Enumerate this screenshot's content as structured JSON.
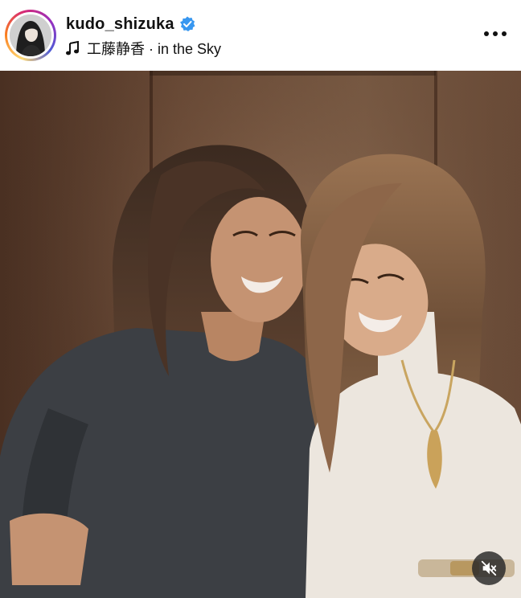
{
  "post_header": {
    "username": "kudo_shizuka",
    "verified": true,
    "audio_label": "工藤静香 · in the Sky",
    "avatar_icon": "profile-photo",
    "more_icon": "more-horizontal-icon",
    "audio_icon": "music-note-icon"
  },
  "media": {
    "type": "photo",
    "mute_icon": "speaker-muted-icon"
  },
  "colors": {
    "verified_badge": "#3897f0",
    "avatar_ring": [
      "#feda75",
      "#fa7e1e",
      "#d62976",
      "#962fbf",
      "#4f5bd5"
    ],
    "text_primary": "#111111"
  }
}
